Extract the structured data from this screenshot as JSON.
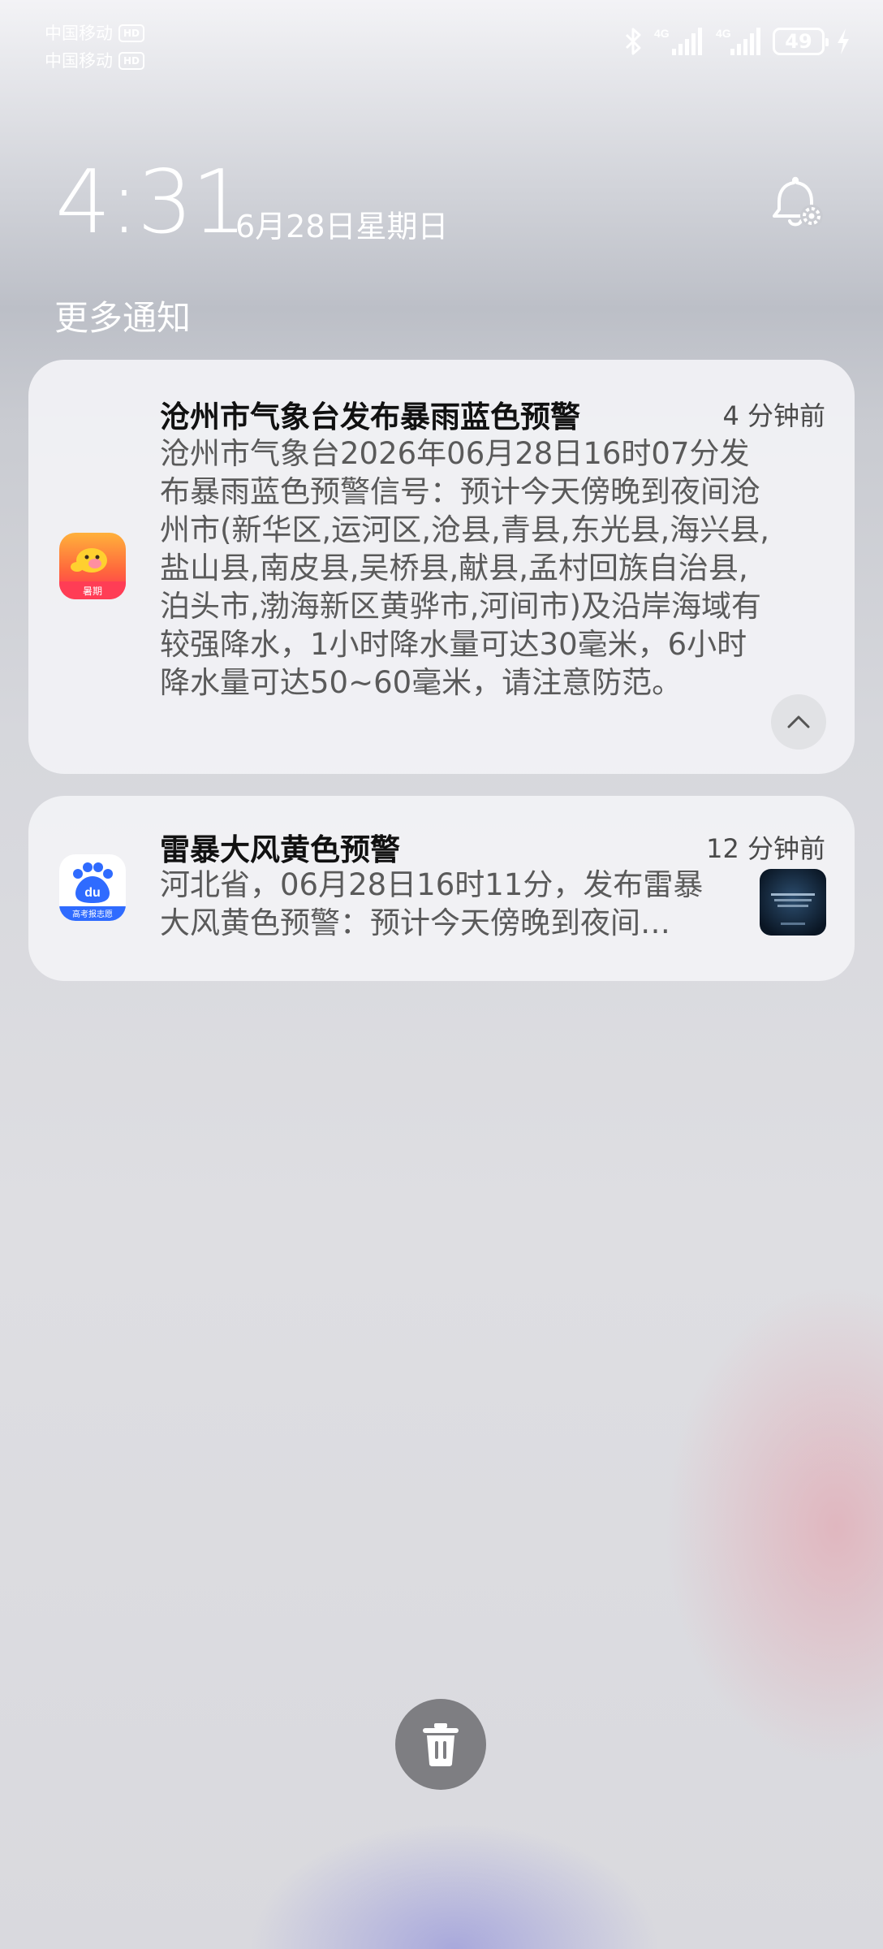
{
  "status_bar": {
    "carriers": [
      {
        "name": "中国移动",
        "badge": "HD"
      },
      {
        "name": "中国移动",
        "badge": "HD"
      }
    ],
    "network_1": "4G",
    "network_2": "4G",
    "battery": "49",
    "icons": [
      "bluetooth-icon",
      "signal-icon",
      "signal-icon",
      "battery-icon",
      "charging-icon"
    ]
  },
  "lock_screen": {
    "time": "4:31",
    "date": "6月28日星期日",
    "section_label": "更多通知"
  },
  "notifications": [
    {
      "title": "沧州市气象台发布暴雨蓝色预警",
      "time": "4 分钟前",
      "app_icon_label": "暑期",
      "body": "沧州市气象台2026年06月28日16时07分发布暴雨蓝色预警信号：预计今天傍晚到夜间沧州市(新华区,运河区,沧县,青县,东光县,海兴县,盐山县,南皮县,吴桥县,献县,孟村回族自治县,泊头市,渤海新区黄骅市,河间市)及沿岸海域有较强降水，1小时降水量可达30毫米，6小时降水量可达50~60毫米，请注意防范。"
    },
    {
      "title": "雷暴大风黄色预警",
      "time": "12 分钟前",
      "app_icon_label": "du",
      "app_icon_sub": "高考报志愿",
      "body": "河北省，06月28日16时11分，发布雷暴大风黄色预警：预计今天傍晚到夜间…"
    }
  ],
  "colors": {
    "card_bg": "#f2f2f5",
    "trash_button": "#7e7e82",
    "app1_accent": "#ff3d55",
    "app2_accent": "#2f6bff"
  }
}
